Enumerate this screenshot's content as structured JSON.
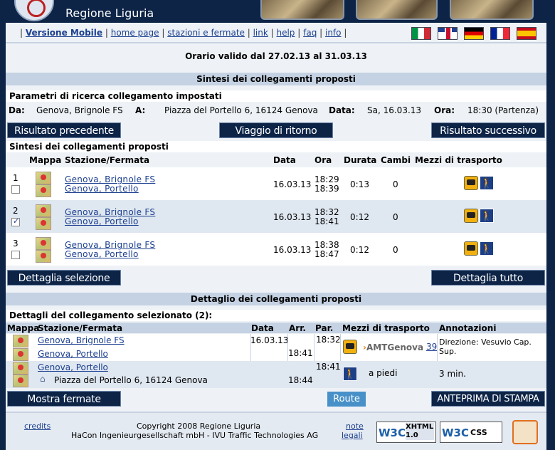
{
  "header": {
    "brand": "Regione Liguria"
  },
  "nav": {
    "items": [
      "Versione Mobile",
      "home page",
      "stazioni e fermate",
      "link",
      "help",
      "faq",
      "info"
    ]
  },
  "validity": "Orario valido dal 27.02.13 al 31.03.13",
  "synthesis_title": "Sintesi dei collegamenti proposti",
  "params": {
    "title": "Parametri di ricerca collegamento impostati",
    "from_label": "Da:",
    "from_value": "Genova, Brignole FS",
    "to_label": "A:",
    "to_value": "Piazza del Portello 6, 16124 Genova",
    "date_label": "Data:",
    "date_value": "Sa, 16.03.13",
    "time_label": "Ora:",
    "time_value": "18:30 (Partenza)"
  },
  "buttons": {
    "prev": "Risultato precedente",
    "return": "Viaggio di ritorno",
    "next": "Risultato successivo",
    "detail_selection": "Dettaglia selezione",
    "detail_all": "Dettaglia tutto",
    "show_stops": "Mostra fermate",
    "route": "Route",
    "print_preview": "ANTEPRIMA DI STAMPA"
  },
  "summary": {
    "title": "Sintesi dei collegamenti proposti",
    "headers": {
      "map": "Mappa",
      "station": "Stazione/Fermata",
      "date": "Data",
      "time": "Ora",
      "duration": "Durata",
      "changes": "Cambi",
      "transport": "Mezzi di trasporto"
    },
    "rows": [
      {
        "num": "1",
        "from": "Genova, Brignole FS",
        "to": "Genova, Portello",
        "date": "16.03.13",
        "dep": "18:29",
        "arr": "18:39",
        "duration": "0:13",
        "changes": "0",
        "checked": false
      },
      {
        "num": "2",
        "from": "Genova, Brignole FS",
        "to": "Genova, Portello",
        "date": "16.03.13",
        "dep": "18:32",
        "arr": "18:41",
        "duration": "0:12",
        "changes": "0",
        "checked": true
      },
      {
        "num": "3",
        "from": "Genova, Brignole FS",
        "to": "Genova, Portello",
        "date": "16.03.13",
        "dep": "18:38",
        "arr": "18:47",
        "duration": "0:12",
        "changes": "0",
        "checked": false
      }
    ]
  },
  "detail": {
    "bar_title": "Dettaglio dei collegamenti proposti",
    "title": "Dettagli del collegamento selezionato (2):",
    "headers": {
      "map": "Mappa",
      "station": "Stazione/Fermata",
      "date": "Data",
      "arr": "Arr.",
      "dep": "Par.",
      "transport": "Mezzi di trasporto",
      "notes": "Annotazioni"
    },
    "leg1": {
      "from": "Genova, Brignole FS",
      "to": "Genova, Portello",
      "date": "16.03.13",
      "dep": "18:32",
      "arr": "18:41",
      "operator": "AMTGenova",
      "line": "39",
      "note": "Direzione: Vesuvio Cap. Sup."
    },
    "leg2": {
      "from": "Genova, Portello",
      "to": "Piazza del Portello 6, 16124 Genova",
      "dep": "18:41",
      "arr": "18:44",
      "mode": "a piedi",
      "note": "3 min."
    }
  },
  "footer": {
    "credits": "credits",
    "copyright1": "Copyright 2008 Regione Liguria",
    "copyright2": "HaCon Ingenieurgesellschaft mbH - IVU Traffic Technologies AG",
    "legal1": "note",
    "legal2": "legali",
    "xhtml": "XHTML 1.0",
    "css": "CSS"
  }
}
